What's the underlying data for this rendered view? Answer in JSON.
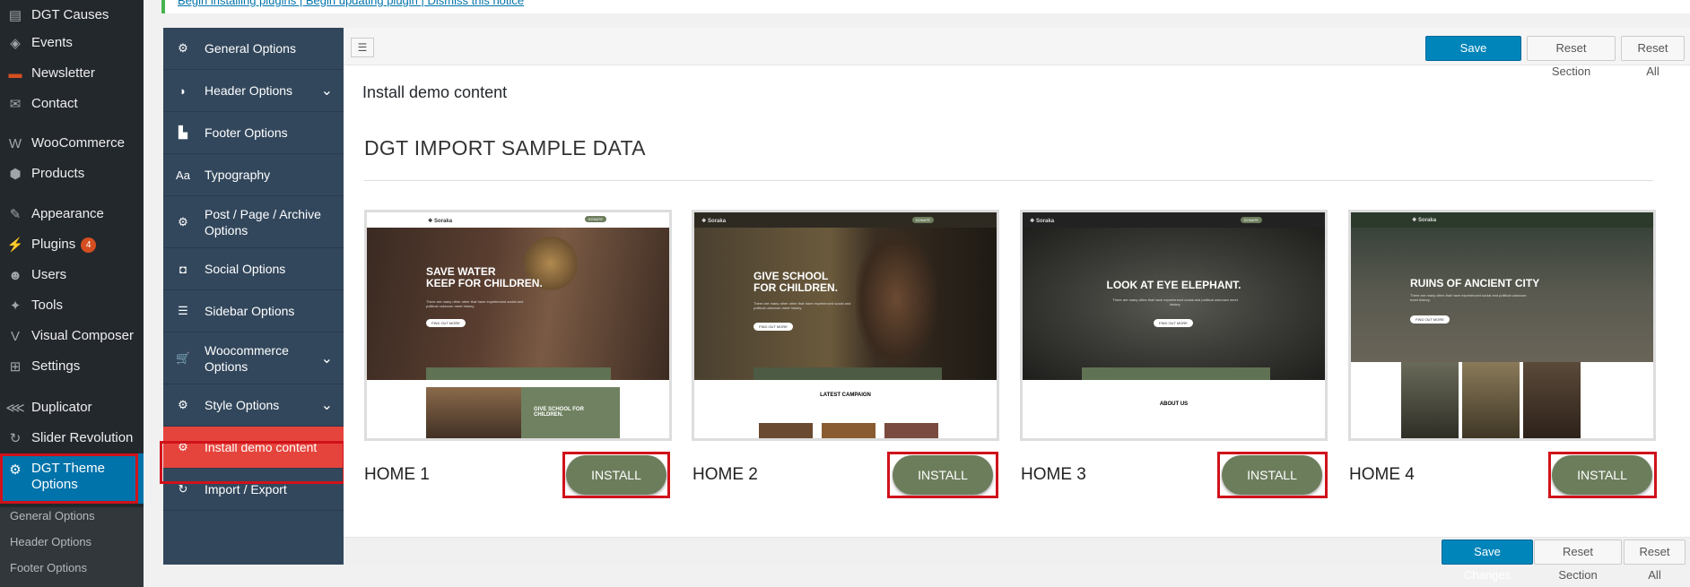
{
  "wp_menu": {
    "items": [
      {
        "label": "DGT Causes",
        "icon": "causes-icon"
      },
      {
        "label": "Events",
        "icon": "megaphone-icon"
      },
      {
        "label": "Newsletter",
        "icon": "newsletter-icon"
      },
      {
        "label": "Contact",
        "icon": "mail-icon"
      },
      {
        "label": "WooCommerce",
        "icon": "woo-icon"
      },
      {
        "label": "Products",
        "icon": "box-icon"
      },
      {
        "label": "Appearance",
        "icon": "brush-icon"
      },
      {
        "label": "Plugins",
        "icon": "plug-icon",
        "badge": "4"
      },
      {
        "label": "Users",
        "icon": "users-icon"
      },
      {
        "label": "Tools",
        "icon": "wrench-icon"
      },
      {
        "label": "Visual Composer",
        "icon": "vc-icon"
      },
      {
        "label": "Settings",
        "icon": "settings-icon"
      },
      {
        "label": "Duplicator",
        "icon": "share-icon"
      },
      {
        "label": "Slider Revolution",
        "icon": "refresh-icon"
      },
      {
        "label": "DGT Theme\nOptions",
        "icon": "gear-icon"
      }
    ],
    "submenu": [
      "General Options",
      "Header Options",
      "Footer Options"
    ]
  },
  "notice": {
    "text": "Begin installing plugins | Begin updating plugin | Dismiss this notice"
  },
  "options_nav": [
    {
      "label": "General Options",
      "icon": "gear-icon"
    },
    {
      "label": "Header Options",
      "icon": "header-icon",
      "chevron": true
    },
    {
      "label": "Footer Options",
      "icon": "footer-icon"
    },
    {
      "label": "Typography",
      "icon": "typography-icon",
      "glyph": "Aa"
    },
    {
      "label": "Post / Page / Archive\nOptions",
      "icon": "gear-icon"
    },
    {
      "label": "Social Options",
      "icon": "social-icon"
    },
    {
      "label": "Sidebar Options",
      "icon": "list-icon"
    },
    {
      "label": "Woocommerce\nOptions",
      "icon": "cart-icon",
      "chevron": true
    },
    {
      "label": "Style Options",
      "icon": "gear-icon",
      "chevron": true
    },
    {
      "label": "Install demo content",
      "icon": "gear-icon",
      "active": true
    },
    {
      "label": "Import / Export",
      "icon": "refresh-icon"
    }
  ],
  "toolbar": {
    "save": "Save Changes",
    "reset_section": "Reset Section",
    "reset_all": "Reset All"
  },
  "section_title": "Install demo content",
  "import_title": "DGT IMPORT SAMPLE DATA",
  "demos": [
    {
      "name": "HOME 1",
      "install": "INSTALL",
      "headline": "SAVE WATER\nKEEP FOR CHILDREN.",
      "sub": "GIVE SCHOOL FOR\nCHILDREN."
    },
    {
      "name": "HOME 2",
      "install": "INSTALL",
      "headline": "GIVE SCHOOL\nFOR CHILDREN.",
      "sub": "LATEST CAMPAIGN"
    },
    {
      "name": "HOME 3",
      "install": "INSTALL",
      "headline": "LOOK AT EYE ELEPHANT.",
      "sub": "ABOUT US"
    },
    {
      "name": "HOME 4",
      "install": "INSTALL",
      "headline": "RUINS OF ANCIENT CITY",
      "sub": ""
    }
  ],
  "colors": {
    "wp_sidebar": "#23282d",
    "wp_active": "#0073aa",
    "options_nav": "#32475c",
    "active_option": "#e5443c",
    "install_button": "#6c7d5c",
    "primary_button": "#0085ba",
    "highlight_outline": "#d0121b"
  }
}
